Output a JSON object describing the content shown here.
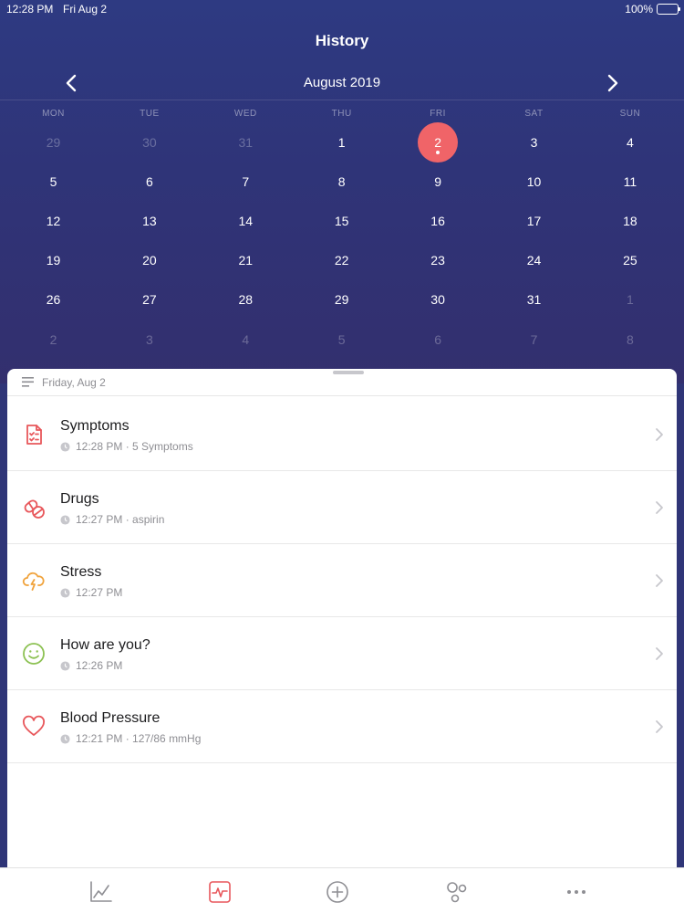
{
  "status": {
    "time": "12:28 PM",
    "date": "Fri Aug 2",
    "battery": "100%"
  },
  "header": {
    "title": "History"
  },
  "calendar": {
    "month_label": "August 2019",
    "weekdays": [
      "MON",
      "TUE",
      "WED",
      "THU",
      "FRI",
      "SAT",
      "SUN"
    ],
    "weeks": [
      [
        {
          "d": "29",
          "m": true
        },
        {
          "d": "30",
          "m": true
        },
        {
          "d": "31",
          "m": true
        },
        {
          "d": "1"
        },
        {
          "d": "2",
          "sel": true
        },
        {
          "d": "3"
        },
        {
          "d": "4"
        }
      ],
      [
        {
          "d": "5"
        },
        {
          "d": "6"
        },
        {
          "d": "7"
        },
        {
          "d": "8"
        },
        {
          "d": "9"
        },
        {
          "d": "10"
        },
        {
          "d": "11"
        }
      ],
      [
        {
          "d": "12"
        },
        {
          "d": "13"
        },
        {
          "d": "14"
        },
        {
          "d": "15"
        },
        {
          "d": "16"
        },
        {
          "d": "17"
        },
        {
          "d": "18"
        }
      ],
      [
        {
          "d": "19"
        },
        {
          "d": "20"
        },
        {
          "d": "21"
        },
        {
          "d": "22"
        },
        {
          "d": "23"
        },
        {
          "d": "24"
        },
        {
          "d": "25"
        }
      ],
      [
        {
          "d": "26"
        },
        {
          "d": "27"
        },
        {
          "d": "28"
        },
        {
          "d": "29"
        },
        {
          "d": "30"
        },
        {
          "d": "31"
        },
        {
          "d": "1",
          "m": true
        }
      ],
      [
        {
          "d": "2",
          "m": true
        },
        {
          "d": "3",
          "m": true
        },
        {
          "d": "4",
          "m": true
        },
        {
          "d": "5",
          "m": true
        },
        {
          "d": "6",
          "m": true
        },
        {
          "d": "7",
          "m": true
        },
        {
          "d": "8",
          "m": true
        }
      ]
    ],
    "selected_color": "#f06468"
  },
  "sheet": {
    "header_label": "Friday, Aug 2",
    "entries": [
      {
        "icon": "symptoms-clipboard-icon",
        "color": "#e8575b",
        "title": "Symptoms",
        "subtitle": "12:28 PM · 5 Symptoms"
      },
      {
        "icon": "pill-icon",
        "color": "#e8575b",
        "title": "Drugs",
        "subtitle": "12:27 PM · aspirin"
      },
      {
        "icon": "storm-cloud-icon",
        "color": "#f0a23b",
        "title": "Stress",
        "subtitle": "12:27 PM"
      },
      {
        "icon": "smiley-face-icon",
        "color": "#8cc152",
        "title": "How are you?",
        "subtitle": "12:26 PM"
      },
      {
        "icon": "heart-icon",
        "color": "#e8575b",
        "title": "Blood Pressure",
        "subtitle": "12:21 PM · 127/86 mmHg"
      }
    ]
  },
  "tabbar": {
    "tabs": [
      "chart-line-icon",
      "health-record-icon",
      "add-circle-icon",
      "molecules-icon",
      "more-dots-icon"
    ],
    "active_color": "#e8575b",
    "inactive_color": "#8e8e93"
  }
}
